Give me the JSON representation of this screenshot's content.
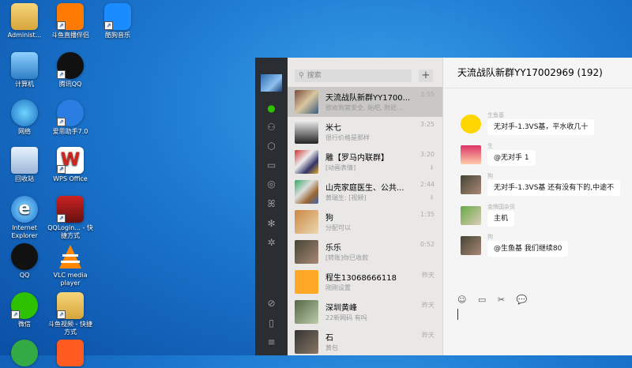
{
  "desktop": {
    "icons": [
      {
        "label": "Administ...",
        "icon": "folder-icon"
      },
      {
        "label": "斗鱼直播伴侣",
        "icon": "douyu-icon"
      },
      {
        "label": "酷狗音乐",
        "icon": "kugou-icon"
      },
      {
        "label": "计算机",
        "icon": "computer-icon"
      },
      {
        "label": "腾讯QQ",
        "icon": "qq-icon"
      },
      {
        "label": "网络",
        "icon": "network-icon"
      },
      {
        "label": "爱思助手7.0",
        "icon": "aisi-icon"
      },
      {
        "label": "回收站",
        "icon": "recycle-bin-icon"
      },
      {
        "label": "WPS Office",
        "icon": "wps-icon"
      },
      {
        "label": "Internet Explorer",
        "icon": "ie-icon"
      },
      {
        "label": "QQLogin... - 快捷方式",
        "icon": "qqlogin-icon"
      },
      {
        "label": "QQ",
        "icon": "qq-icon"
      },
      {
        "label": "VLC media player",
        "icon": "vlc-icon"
      },
      {
        "label": "微信",
        "icon": "wechat-icon"
      },
      {
        "label": "斗鱼视频 - 快捷方式",
        "icon": "douyu-video-icon"
      }
    ]
  },
  "wechat": {
    "search_placeholder": "搜索",
    "plus_label": "+",
    "nav_icons": [
      "chat-icon",
      "contacts-icon",
      "box-icon",
      "folder-icon",
      "moments-icon",
      "butterfly-icon",
      "settings-icon",
      "mini-program-icon",
      "phone-icon",
      "menu-icon"
    ],
    "conversations": [
      {
        "name": "天流战队新群YY1700...",
        "preview": "欲收狗第安全, 贴吧, 附近...",
        "time": "3:55",
        "muted": "",
        "selected": true
      },
      {
        "name": "米七",
        "preview": "很行价格是那样",
        "time": "3:25",
        "muted": "",
        "selected": false
      },
      {
        "name": "雕【罗马内联群】",
        "preview": "[动画表情]",
        "time": "3:20",
        "muted": "⍋",
        "selected": false
      },
      {
        "name": "山壳家庭医生、公共...",
        "preview": "黄瑞生: [视频]",
        "time": "2:44",
        "muted": "⍋",
        "selected": false
      },
      {
        "name": "狗",
        "preview": "分配可以",
        "time": "1:35",
        "muted": "",
        "selected": false
      },
      {
        "name": "乐乐",
        "preview": "[转账]你已收款",
        "time": "0:52",
        "muted": "",
        "selected": false
      },
      {
        "name": "程生13068666118",
        "preview": "刚刚设置",
        "time": "昨天",
        "muted": "",
        "selected": false
      },
      {
        "name": "深圳黄峰",
        "preview": "22新网码 有吗",
        "time": "昨天",
        "muted": "",
        "selected": false
      },
      {
        "name": "石",
        "preview": "黄包",
        "time": "昨天",
        "muted": "",
        "selected": false
      }
    ],
    "chat": {
      "title": "天流战队新群YY17002969 (192)",
      "messages": [
        {
          "sender": "生鱼基",
          "text": "无对手-1.3VS基，平水收几十"
        },
        {
          "sender": "生",
          "text": "@无对手 1"
        },
        {
          "sender": "狗",
          "text": "无对手-1.3VS基 还有没有下的,中途不"
        },
        {
          "sender": "金牌国杂货",
          "text": "主机"
        },
        {
          "sender": "狗",
          "text": "@生鱼基 我们继续80"
        }
      ],
      "toolbar": [
        "emoji-icon",
        "folder-icon",
        "scissors-icon",
        "chat-bubble-icon"
      ]
    }
  },
  "colors": {
    "accent": "#2dc100",
    "nav_bg": "#2a2d31",
    "list_bg": "#e9e8e7"
  }
}
